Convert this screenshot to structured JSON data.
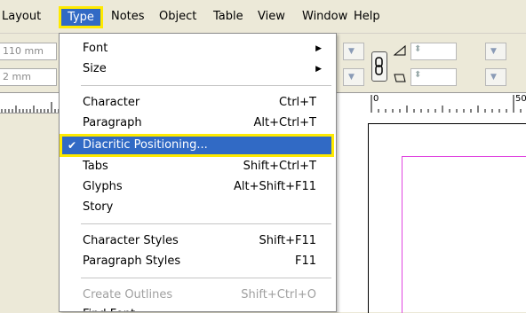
{
  "menubar": {
    "items": [
      {
        "label": "Layout"
      },
      {
        "label": "Type"
      },
      {
        "label": "Notes"
      },
      {
        "label": "Object"
      },
      {
        "label": "Table"
      },
      {
        "label": "View"
      },
      {
        "label": "Window"
      },
      {
        "label": "Help"
      }
    ]
  },
  "toolbar": {
    "field1": "110 mm",
    "field2": "2 mm",
    "ruler_left_tick": "",
    "ruler_right_labels": [
      "0",
      "50"
    ]
  },
  "type_menu": {
    "items": [
      {
        "label": "Font",
        "submenu": true
      },
      {
        "label": "Size",
        "submenu": true
      },
      {
        "label": "Character",
        "shortcut": "Ctrl+T"
      },
      {
        "label": "Paragraph",
        "shortcut": "Alt+Ctrl+T"
      },
      {
        "label": "Diacritic Positioning...",
        "checked": true
      },
      {
        "label": "Tabs",
        "shortcut": "Shift+Ctrl+T"
      },
      {
        "label": "Glyphs",
        "shortcut": "Alt+Shift+F11"
      },
      {
        "label": "Story"
      },
      {
        "label": "Character Styles",
        "shortcut": "Shift+F11"
      },
      {
        "label": "Paragraph Styles",
        "shortcut": "F11"
      },
      {
        "label": "Create Outlines",
        "shortcut": "Shift+Ctrl+O",
        "disabled": true
      },
      {
        "label": "Find Font..."
      }
    ],
    "checkmark": "✔",
    "arrow": "▶"
  },
  "colors": {
    "highlight": "#316ac5",
    "callout": "#ffea00",
    "guide": "#e046e0"
  }
}
